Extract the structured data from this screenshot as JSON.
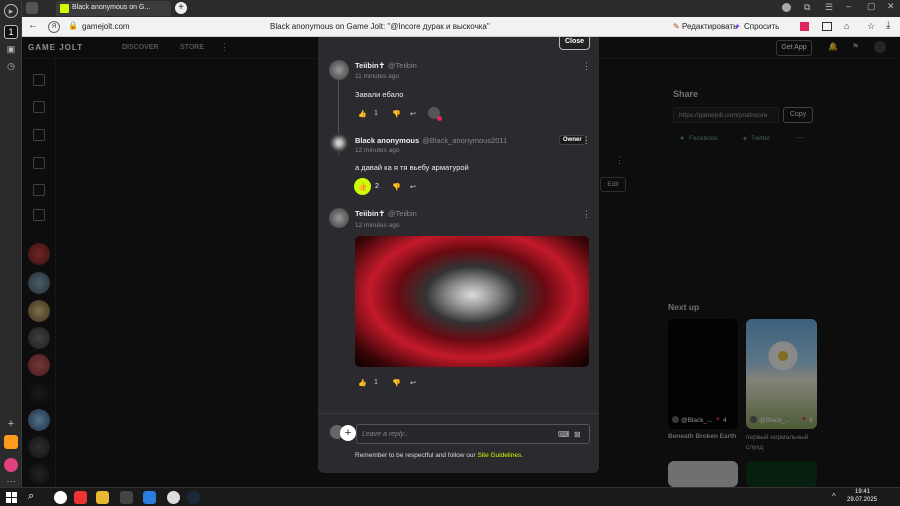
{
  "browser": {
    "tab_title": "Black anonymous on G...",
    "url": "gamejolt.com",
    "page_title": "Black anonymous on Game Jolt: \"@Incore дурак и выскочка\"",
    "edit_label": "Редактировать",
    "ask_label": "Спросить"
  },
  "gj_nav": {
    "logo": "GAME JOLT",
    "discover": "DISCOVER",
    "store": "STORE",
    "get_app": "Get App"
  },
  "modal": {
    "close_label": "Close",
    "comments": [
      {
        "user": "Teiibin✝",
        "handle": "@Teiibin",
        "time": "11 minutes ago",
        "text": "Завали ебало",
        "likes": "1"
      },
      {
        "user": "Black anonymous",
        "handle": "@Black_anonymous2011",
        "owner": "Owner",
        "time": "12 minutes ago",
        "text": "а давай ка я тя вьебу арматурой",
        "likes": "2"
      },
      {
        "user": "Teiibin✝",
        "handle": "@Teiibin",
        "time": "12 minutes ago",
        "text": "",
        "likes": "1"
      }
    ],
    "reply_placeholder": "Leave a reply...",
    "guidelines_prefix": "Remember to be respectful and follow our",
    "guidelines_link": "Site Guidelines",
    "guidelines_suffix": "."
  },
  "right": {
    "share_title": "Share",
    "share_url": "https://gamejolt.com/p/atincore",
    "copy_label": "Copy",
    "facebook": "Facebook",
    "twitter": "Twitter",
    "edit_label": "Edit",
    "next_up": "Next up",
    "cards": [
      {
        "user": "@Black_...",
        "likes": "4",
        "title": "Beneath Broken Earth"
      },
      {
        "user": "@Black_...",
        "likes": "4",
        "title": "первый нормальный\nслуxд"
      }
    ]
  },
  "taskbar": {
    "time": "19:41",
    "date": "29.07.2025"
  },
  "colors": {
    "accent": "#ccff00",
    "link": "#ccff00",
    "modal_bg": "#2a2a2f",
    "page_bg": "#191919"
  }
}
